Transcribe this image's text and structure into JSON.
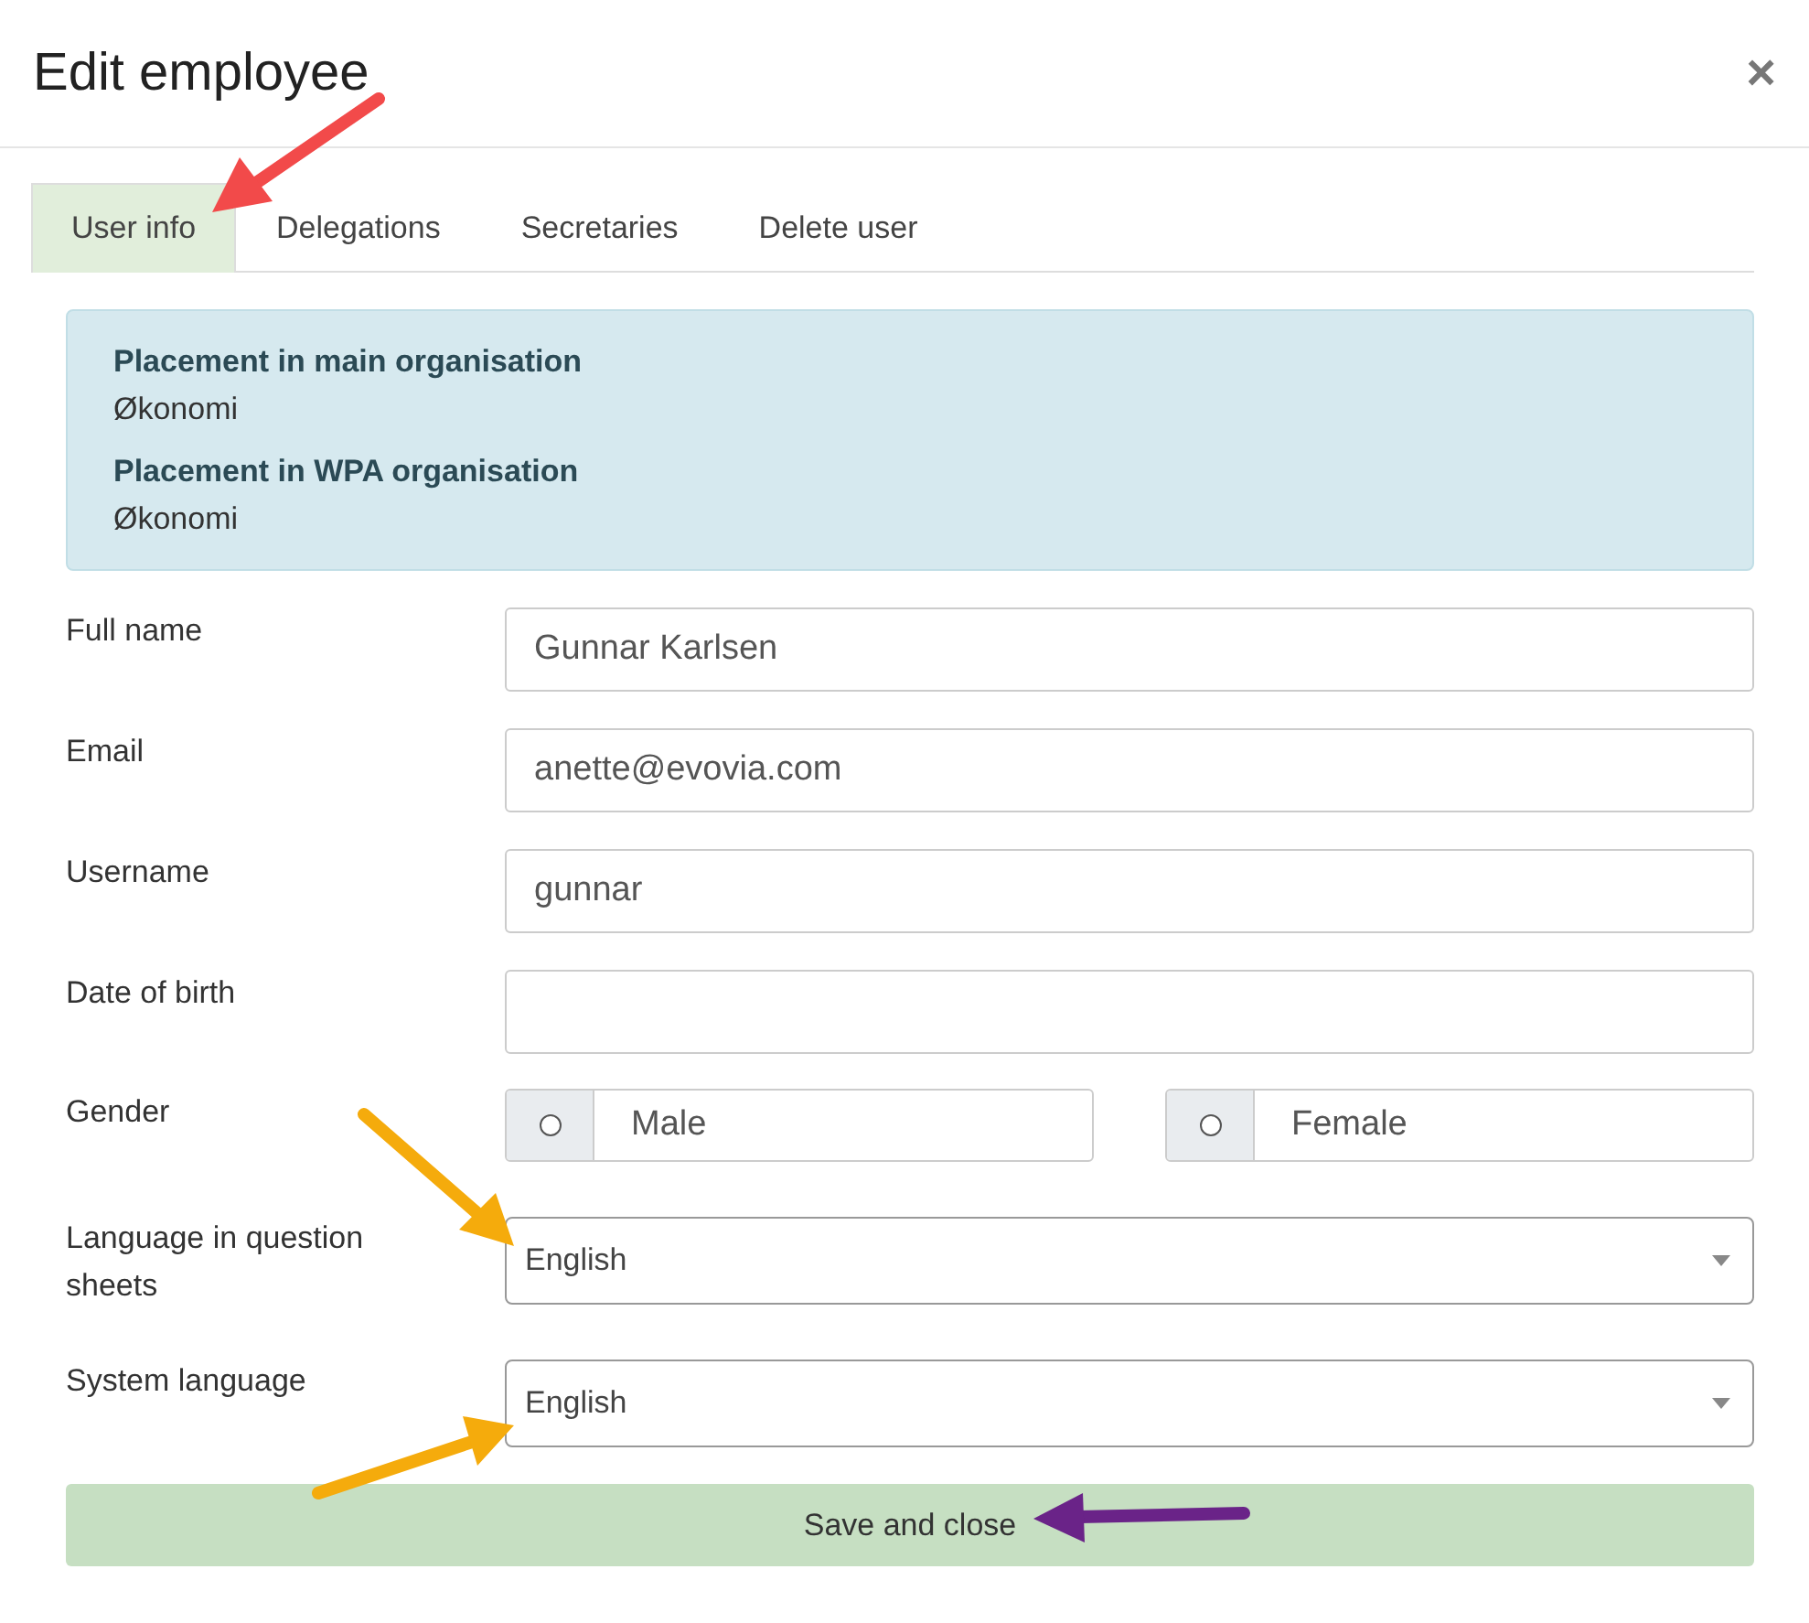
{
  "dialog": {
    "title": "Edit employee",
    "close_icon": "×"
  },
  "tabs": [
    {
      "label": "User info",
      "selected": true
    },
    {
      "label": "Delegations",
      "selected": false
    },
    {
      "label": "Secretaries",
      "selected": false
    },
    {
      "label": "Delete user",
      "selected": false
    }
  ],
  "placements": [
    {
      "heading": "Placement in main organisation",
      "value": "Økonomi"
    },
    {
      "heading": "Placement in WPA organisation",
      "value": "Økonomi"
    }
  ],
  "fields": [
    {
      "kind": "text",
      "label": "Full name",
      "value": "Gunnar Karlsen"
    },
    {
      "kind": "text",
      "label": "Email",
      "value": "anette@evovia.com"
    },
    {
      "kind": "text",
      "label": "Username",
      "value": "gunnar"
    },
    {
      "kind": "text",
      "label": "Date of birth"
    },
    {
      "kind": "radio",
      "label": "Gender",
      "options": [
        {
          "label": "Male",
          "selected": false
        },
        {
          "label": "Female",
          "selected": false
        }
      ]
    },
    {
      "kind": "select",
      "label": "Language in question sheets",
      "value": "English"
    },
    {
      "kind": "select",
      "label": "System language",
      "value": "English"
    }
  ],
  "save_button": "Save and close"
}
